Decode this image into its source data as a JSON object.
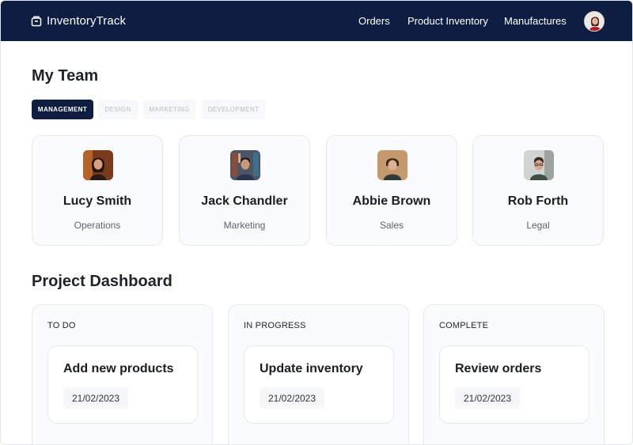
{
  "app": {
    "brand": "InventoryTrack",
    "icon": "box-logo-icon",
    "colors": {
      "navy": "#0d1e42",
      "background": "#ffffff",
      "card": "#fafbfc"
    }
  },
  "nav": {
    "links": [
      "Orders",
      "Product Inventory",
      "Manufactures"
    ],
    "avatar_icon": "user-avatar"
  },
  "team": {
    "title": "My Team",
    "tabs": [
      {
        "label": "MANAGEMENT",
        "active": true
      },
      {
        "label": "DESIGN",
        "active": false
      },
      {
        "label": "MARKETING",
        "active": false
      },
      {
        "label": "DEVELOPMENT",
        "active": false
      }
    ],
    "members": [
      {
        "name": "Lucy Smith",
        "role": "Operations",
        "photo": "woman-portrait"
      },
      {
        "name": "Jack Chandler",
        "role": "Marketing",
        "photo": "man-portrait-bookshelf"
      },
      {
        "name": "Abbie Brown",
        "role": "Sales",
        "photo": "woman-portrait-short-hair"
      },
      {
        "name": "Rob Forth",
        "role": "Legal",
        "photo": "man-portrait-glasses"
      }
    ]
  },
  "dashboard": {
    "title": "Project Dashboard",
    "columns": [
      {
        "title": "TO DO",
        "task": {
          "title": "Add new products",
          "date": "21/02/2023"
        }
      },
      {
        "title": "IN PROGRESS",
        "task": {
          "title": "Update inventory",
          "date": "21/02/2023"
        }
      },
      {
        "title": "COMPLETE",
        "task": {
          "title": "Review orders",
          "date": "21/02/2023"
        }
      }
    ]
  }
}
